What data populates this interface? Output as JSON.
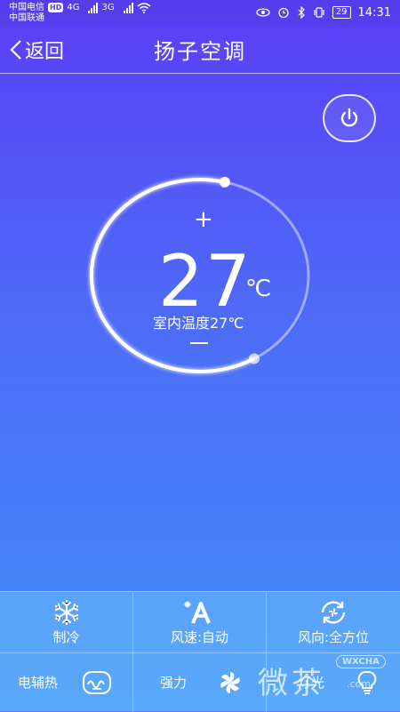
{
  "status_bar": {
    "carrier1": "中国电信",
    "hd": "HD",
    "net1": "4G",
    "net2": "3G",
    "carrier2": "中国联通",
    "battery": "29",
    "time": "14:31"
  },
  "header": {
    "back_label": "返回",
    "title": "扬子空调"
  },
  "dial": {
    "plus": "+",
    "temperature": "27",
    "unit": "℃",
    "indoor": "室内温度27℃",
    "progress": 0.62
  },
  "controls": {
    "mode": "制冷",
    "fan_speed": "风速:自动",
    "wind_direction": "风向:全方位",
    "electric_heat": "电辅热",
    "strong": "强力",
    "light": "灯光"
  },
  "watermark": {
    "text": "微茶",
    "tag": "WXCHA",
    "com": ".com"
  },
  "colors": {
    "bg_top": "#5a3ef6",
    "bg_bottom": "#3f8ff8",
    "white": "#ffffff"
  }
}
